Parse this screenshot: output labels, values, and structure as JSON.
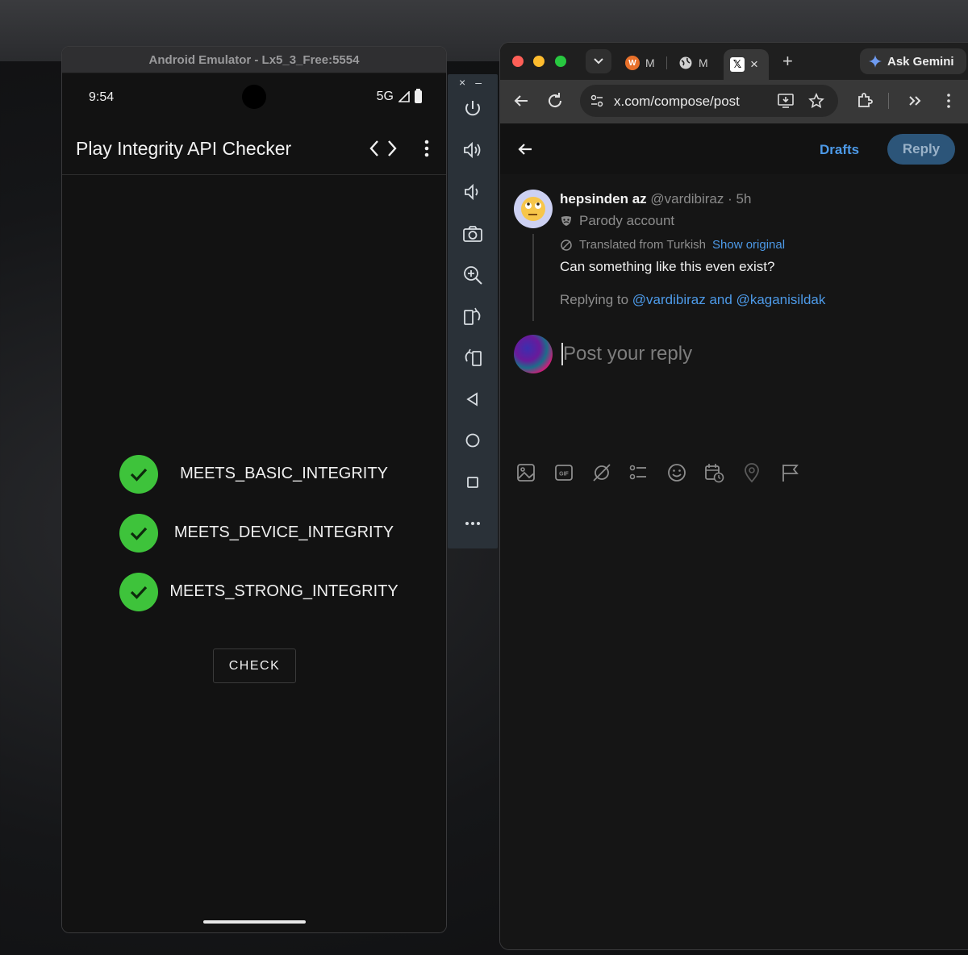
{
  "emulator": {
    "window_title": "Android Emulator - Lx5_3_Free:5554",
    "status": {
      "time": "9:54",
      "network": "5G"
    },
    "app_title": "Play Integrity API Checker",
    "checks": [
      {
        "label": "MEETS_BASIC_INTEGRITY",
        "passed": true
      },
      {
        "label": "MEETS_DEVICE_INTEGRITY",
        "passed": true
      },
      {
        "label": "MEETS_STRONG_INTEGRITY",
        "passed": true
      }
    ],
    "check_button": "CHECK",
    "toolbar": {
      "close_glyph": "×",
      "minimize_glyph": "–",
      "items": [
        "power-icon",
        "volume-up-icon",
        "volume-down-icon",
        "camera-icon",
        "zoom-in-icon",
        "rotate-left-icon",
        "rotate-right-icon",
        "back-icon",
        "home-icon",
        "overview-icon",
        "more-icon"
      ]
    }
  },
  "browser": {
    "tabs": [
      {
        "label": "M",
        "favicon": "W"
      },
      {
        "label": "M",
        "favicon": "globe"
      },
      {
        "label": "",
        "favicon": "X",
        "active": true
      }
    ],
    "new_tab_glyph": "+",
    "gemini_label": "Ask Gemini",
    "url": "x.com/compose/post"
  },
  "compose": {
    "drafts_label": "Drafts",
    "reply_button": "Reply",
    "tweet": {
      "author_name": "hepsinden az",
      "author_handle": "@vardibiraz",
      "time": "· 5h",
      "parody_label": "Parody account",
      "translated_label": "Translated from Turkish",
      "show_original": "Show original",
      "text": "Can something like this even exist?",
      "replying_prefix": "Replying to",
      "replying_mentions": "@vardibiraz and @kaganisildak"
    },
    "reply_placeholder": "Post your reply",
    "colors": {
      "accent": "#4d9ae8",
      "check_green": "#3ec33b",
      "reply_btn_bg": "#2c5579"
    }
  }
}
